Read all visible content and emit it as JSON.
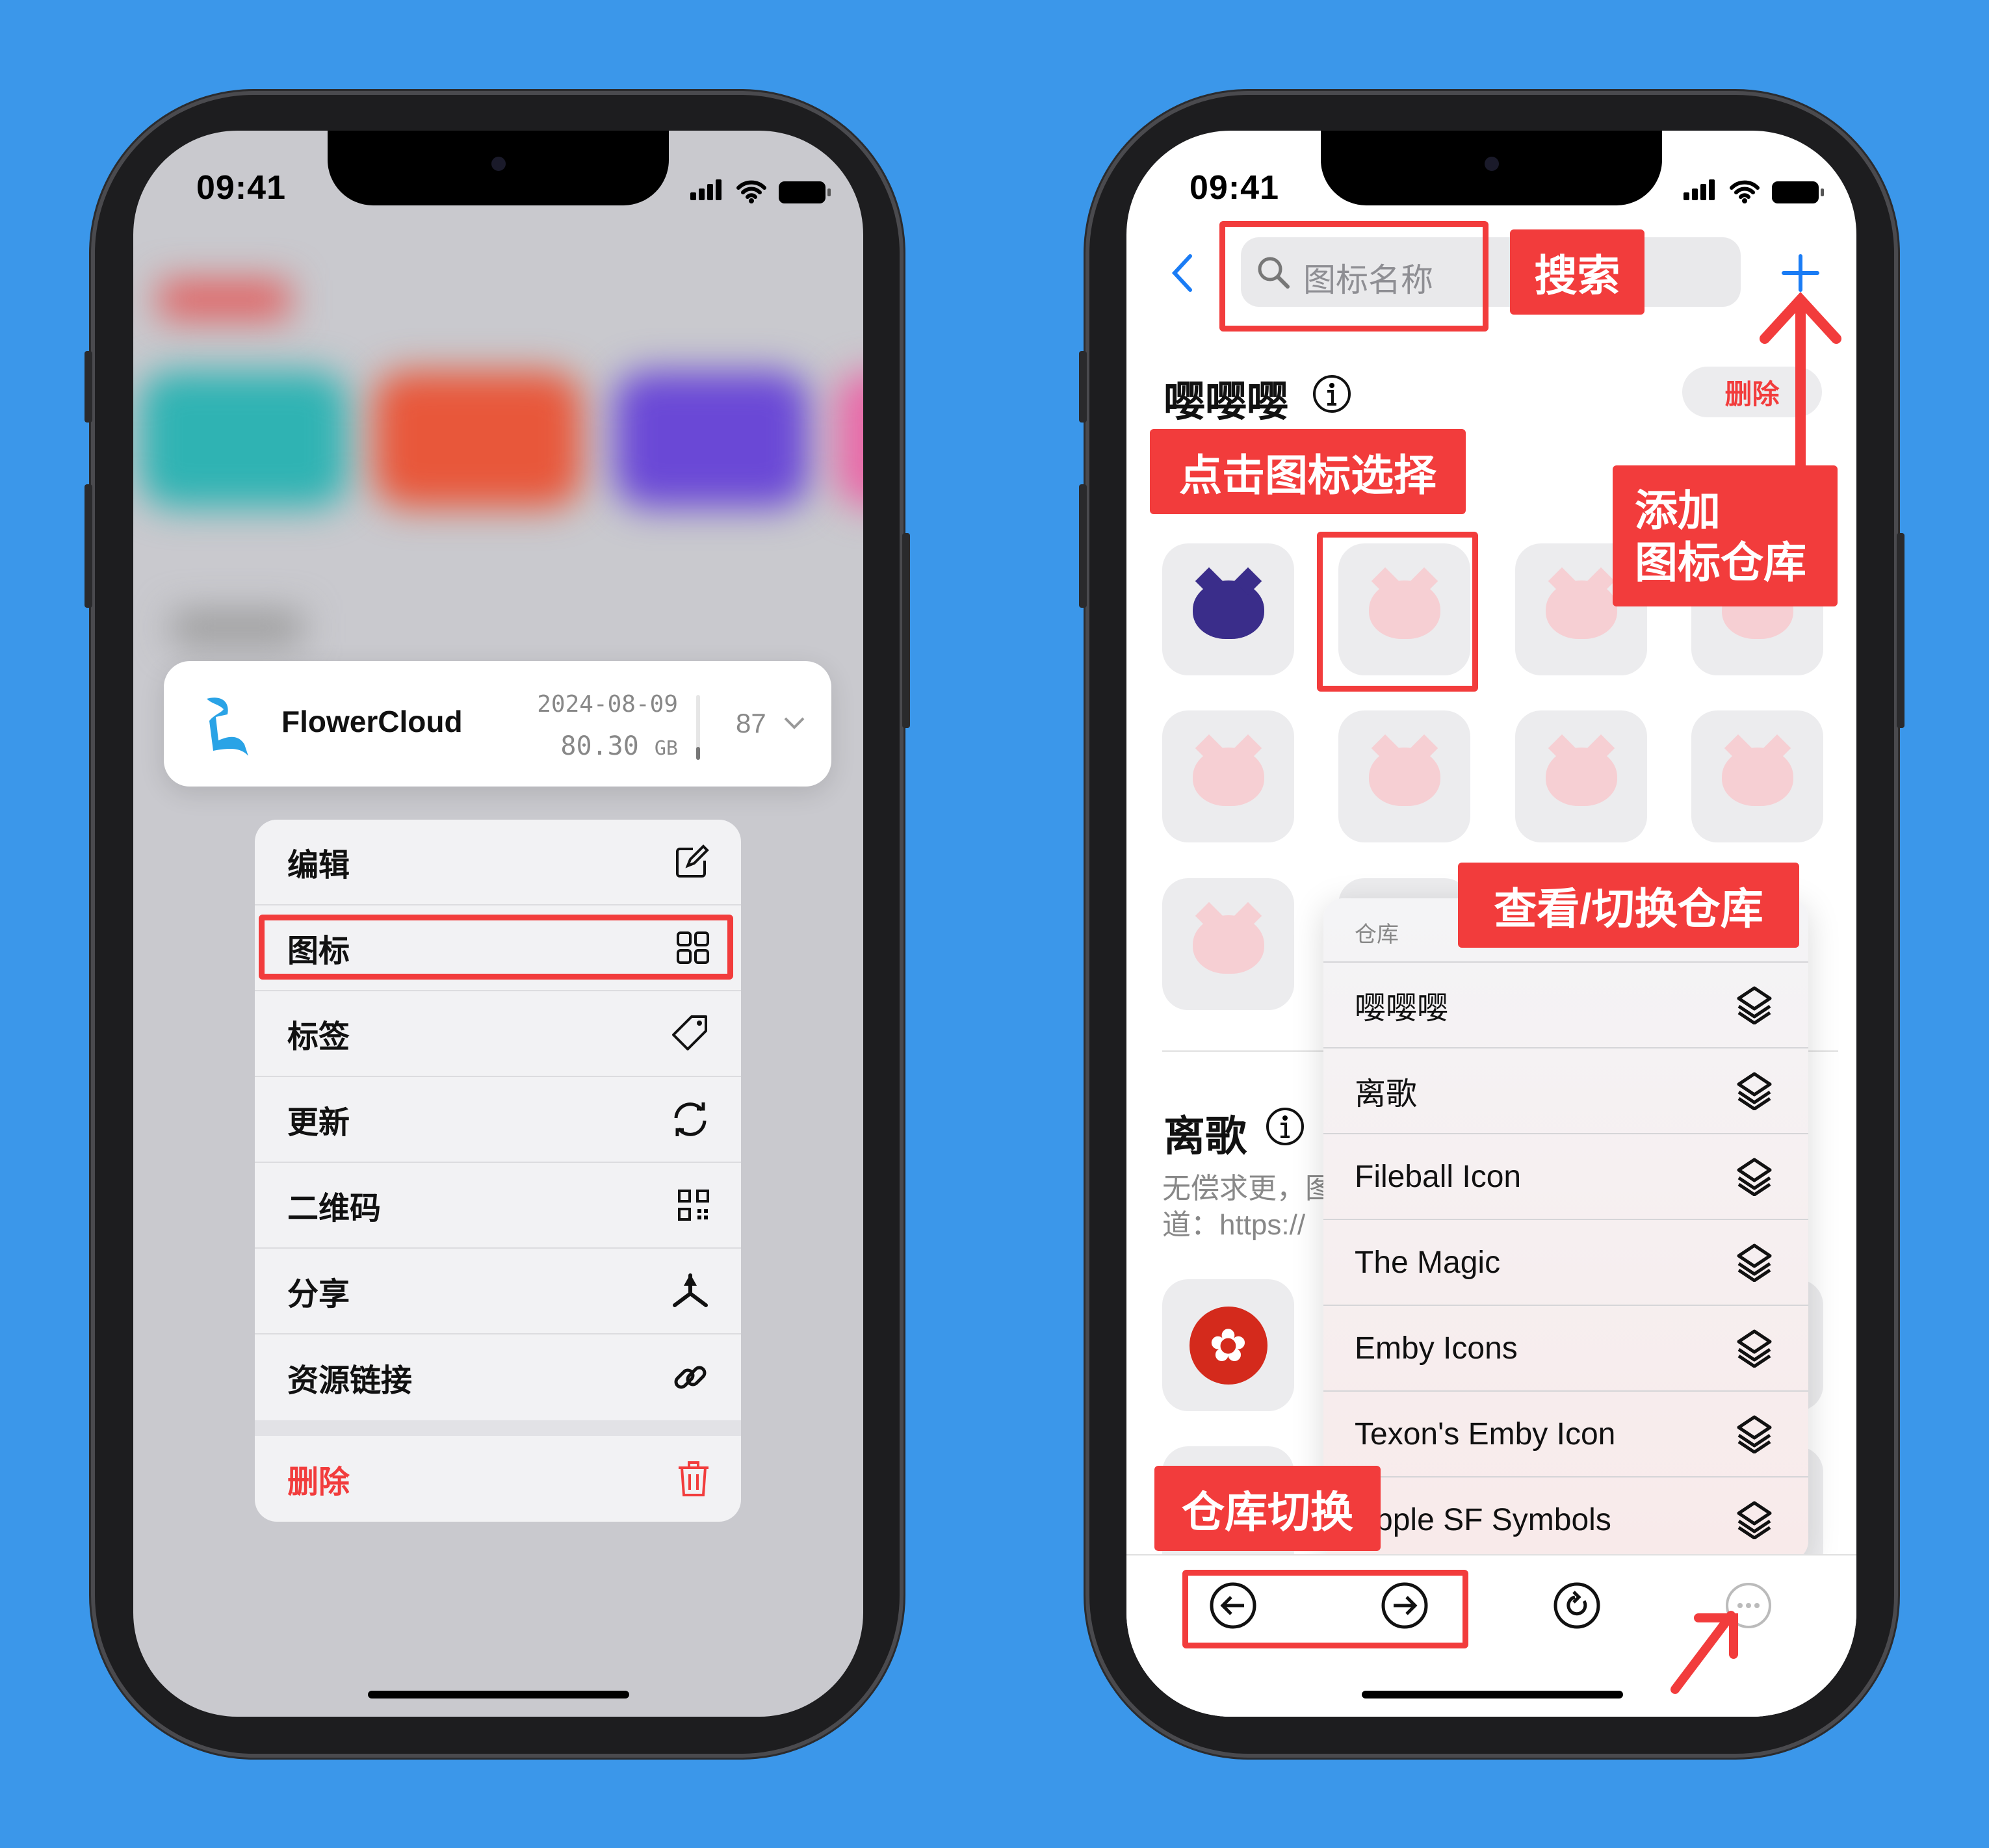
{
  "left_phone": {
    "status_time": "09:41",
    "card": {
      "name": "FlowerCloud",
      "date": "2024-08-09",
      "size_value": "80.30",
      "size_unit": "GB",
      "count": "87"
    },
    "menu": [
      {
        "label": "编辑",
        "icon": "edit-icon"
      },
      {
        "label": "图标",
        "icon": "grid-icon"
      },
      {
        "label": "标签",
        "icon": "tag-icon"
      },
      {
        "label": "更新",
        "icon": "refresh-icon"
      },
      {
        "label": "二维码",
        "icon": "qrcode-icon"
      },
      {
        "label": "分享",
        "icon": "share-icon"
      },
      {
        "label": "资源链接",
        "icon": "link-icon"
      },
      {
        "label": "删除",
        "icon": "trash-icon"
      }
    ]
  },
  "right_phone": {
    "status_time": "09:41",
    "search_placeholder": "图标名称",
    "section1": {
      "title": "嘤嘤嘤",
      "delete_label": "删除"
    },
    "section2": {
      "title": "离歌",
      "desc_line1": "无偿求更，图",
      "desc_line2": "道：https://"
    },
    "popup": {
      "header": "仓库",
      "items": [
        "嘤嘤嘤",
        "离歌",
        "Fileball Icon",
        "The Magic",
        "Emby Icons",
        "Texon's Emby Icon",
        "Apple SF Symbols"
      ]
    },
    "toolbar": [
      "back-circle-icon",
      "forward-circle-icon",
      "reload-icon",
      "more-icon"
    ]
  },
  "annotations": {
    "search": "搜索",
    "tap_select": "点击图标选择",
    "add_repo_line1": "添加",
    "add_repo_line2": "图标仓库",
    "view_switch": "查看/切换仓库",
    "repo_switch": "仓库切换"
  },
  "colors": {
    "background": "#3b97ea",
    "annotation_red": "#f23c3c",
    "ios_blue": "#1a7cf5"
  }
}
